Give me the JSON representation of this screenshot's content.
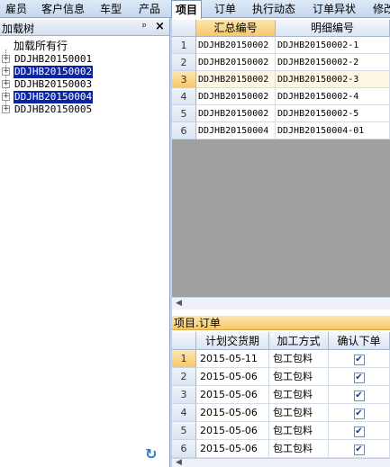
{
  "menu": {
    "tabs": [
      {
        "label": "雇员",
        "active": false
      },
      {
        "label": "客户信息",
        "active": false
      },
      {
        "label": "车型",
        "active": false
      },
      {
        "label": "产品",
        "active": false
      },
      {
        "label": "项目",
        "active": true
      },
      {
        "label": "订单",
        "active": false
      },
      {
        "label": "执行动态",
        "active": false
      },
      {
        "label": "订单异状",
        "active": false
      },
      {
        "label": "修改",
        "active": false
      }
    ]
  },
  "left_panel": {
    "title": "加载树",
    "pin_glyph": "ᵖ",
    "close_glyph": "×",
    "root": "加载所有行",
    "nodes": [
      {
        "label": "DDJHB20150001",
        "selected": false
      },
      {
        "label": "DDJHB20150002",
        "selected": true
      },
      {
        "label": "DDJHB20150003",
        "selected": false
      },
      {
        "label": "DDJHB20150004",
        "selected": true
      },
      {
        "label": "DDJHB20150005",
        "selected": false
      }
    ],
    "refresh_icon": "refresh-icon"
  },
  "grid_top": {
    "columns": [
      "汇总编号",
      "明细编号"
    ],
    "rows": [
      {
        "num": "1",
        "a": "DDJHB20150002",
        "b": "DDJHB20150002-1"
      },
      {
        "num": "2",
        "a": "DDJHB20150002",
        "b": "DDJHB20150002-2"
      },
      {
        "num": "3",
        "a": "DDJHB20150002",
        "b": "DDJHB20150002-3"
      },
      {
        "num": "4",
        "a": "DDJHB20150002",
        "b": "DDJHB20150002-4"
      },
      {
        "num": "5",
        "a": "DDJHB20150002",
        "b": "DDJHB20150002-5"
      },
      {
        "num": "6",
        "a": "DDJHB20150004",
        "b": "DDJHB20150004-01"
      }
    ],
    "current_row": 3
  },
  "sub_panel": {
    "title": "项目.订单",
    "columns": [
      "计划交货期",
      "加工方式",
      "确认下单"
    ],
    "rows": [
      {
        "num": "1",
        "date": "2015-05-11",
        "method": "包工包料",
        "confirmed": true
      },
      {
        "num": "2",
        "date": "2015-05-06",
        "method": "包工包料",
        "confirmed": true
      },
      {
        "num": "3",
        "date": "2015-05-06",
        "method": "包工包料",
        "confirmed": true
      },
      {
        "num": "4",
        "date": "2015-05-06",
        "method": "包工包料",
        "confirmed": true
      },
      {
        "num": "5",
        "date": "2015-05-06",
        "method": "包工包料",
        "confirmed": true
      },
      {
        "num": "6",
        "date": "2015-05-06",
        "method": "包工包料",
        "confirmed": true
      }
    ],
    "current_row": 1
  },
  "colors": {
    "selection": "#0a24a6",
    "accent_header": "#f6c76a"
  }
}
